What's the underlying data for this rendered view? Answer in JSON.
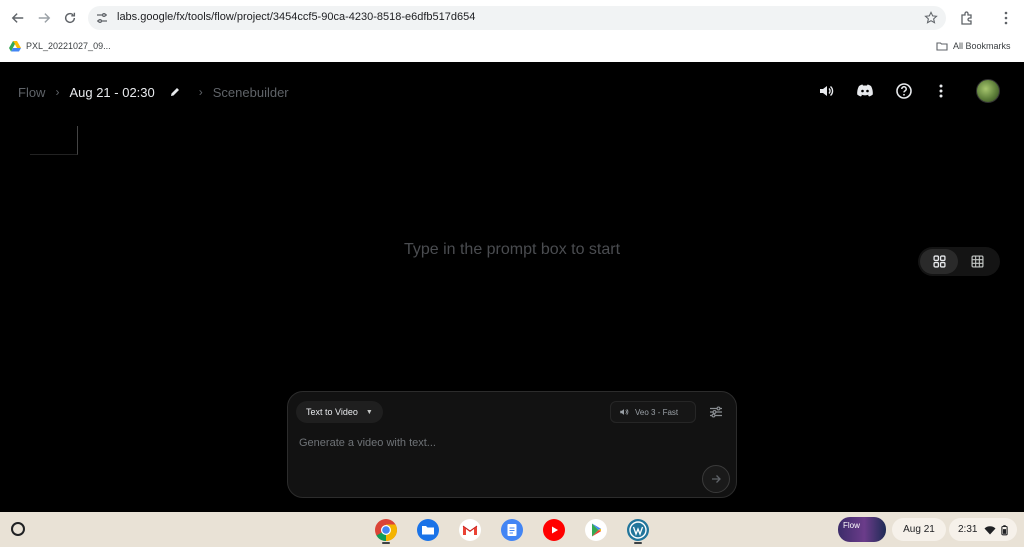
{
  "browser": {
    "url": "labs.google/fx/tools/flow/project/3454ccf5-90ca-4230-8518-e6dfb517d654",
    "bookmarks": [
      {
        "label": "PXL_20221027_09..."
      },
      {
        "label": "All Bookmarks"
      }
    ]
  },
  "breadcrumb": {
    "root": "Flow",
    "project": "Aug 21 - 02:30",
    "page": "Scenebuilder"
  },
  "canvas": {
    "empty_message": "Type in the prompt box to start"
  },
  "prompt": {
    "mode_label": "Text to Video",
    "model_label": "Veo 3 - Fast",
    "placeholder": "Generate a video with text..."
  },
  "shelf": {
    "holding_label": "Flow",
    "date": "Aug 21",
    "time": "2:31"
  },
  "colors": {
    "app_bg": "#000000",
    "shelf_bg": "#e9e2d6",
    "text_dim": "#5f6368",
    "text_light": "#e8eaed"
  }
}
